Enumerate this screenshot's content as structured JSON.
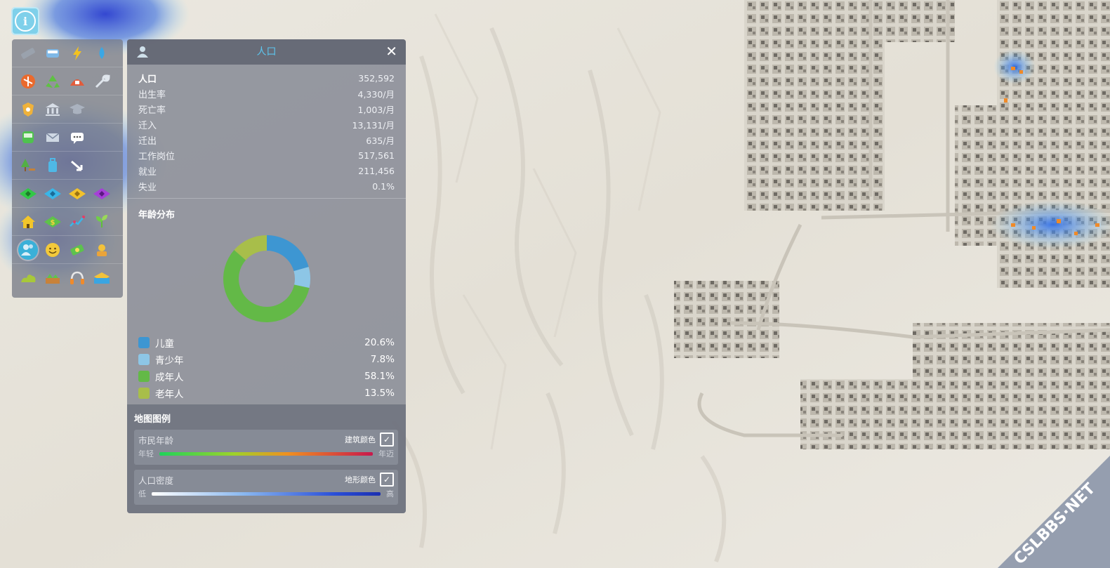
{
  "colors": {
    "accent": "#5cc6ef",
    "children": "#3d96d2",
    "teens": "#8dc6e6",
    "adults": "#63b947",
    "seniors": "#a8be4a"
  },
  "panel": {
    "title": "人口",
    "close_label": "✕",
    "stats": [
      {
        "label": "人口",
        "value": "352,592"
      },
      {
        "label": "出生率",
        "value": "4,330/月"
      },
      {
        "label": "死亡率",
        "value": "1,003/月"
      },
      {
        "label": "迁入",
        "value": "13,131/月"
      },
      {
        "label": "迁出",
        "value": "635/月"
      },
      {
        "label": "工作岗位",
        "value": "517,561"
      },
      {
        "label": "就业",
        "value": "211,456"
      },
      {
        "label": "失业",
        "value": "0.1%"
      }
    ],
    "age_title": "年龄分布",
    "age_groups": [
      {
        "label": "儿童",
        "value": "20.6%",
        "fraction": 0.206,
        "color": "#3d96d2"
      },
      {
        "label": "青少年",
        "value": "7.8%",
        "fraction": 0.078,
        "color": "#8dc6e6"
      },
      {
        "label": "成年人",
        "value": "58.1%",
        "fraction": 0.581,
        "color": "#63b947"
      },
      {
        "label": "老年人",
        "value": "13.5%",
        "fraction": 0.135,
        "color": "#a8be4a"
      }
    ]
  },
  "map_legend": {
    "title": "地图图例",
    "rows": [
      {
        "name": "市民年龄",
        "toggle_label": "建筑颜色",
        "checked": true,
        "low": "年轻",
        "high": "年迈"
      },
      {
        "name": "人口密度",
        "toggle_label": "地形颜色",
        "checked": true,
        "low": "低",
        "high": "高"
      }
    ]
  },
  "toolbar": {
    "rows": [
      [
        "road-icon",
        "transit-bus-icon",
        "electricity-icon",
        "water-drop-icon"
      ],
      [
        "heating-icon",
        "recycle-icon",
        "fire-icon",
        "wrench-icon"
      ],
      [
        "police-badge-icon",
        "bank-icon",
        "education-cap-icon"
      ],
      [
        "bus-icon",
        "mail-icon",
        "chat-bubble-icon"
      ],
      [
        "park-tree-icon",
        "luggage-icon",
        "traffic-arrow-icon"
      ],
      [
        "residential-zone-icon",
        "commercial-zone-icon",
        "industrial-zone-icon",
        "office-zone-icon"
      ],
      [
        "house-icon",
        "land-value-icon",
        "statistics-chart-icon",
        "plant-sprout-icon"
      ],
      [
        "population-icon",
        "happiness-face-icon",
        "money-icon",
        "worker-icon"
      ],
      [
        "pollution-icon",
        "terrain-icon",
        "noise-headphones-icon",
        "water-level-icon"
      ]
    ],
    "active": "population-icon"
  },
  "watermark": "CSLBBS·NET"
}
